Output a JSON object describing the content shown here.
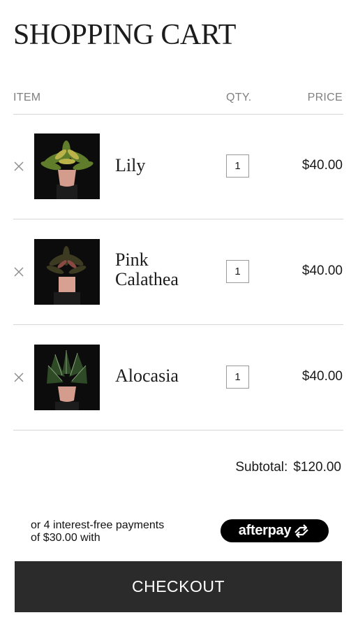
{
  "page": {
    "title": "SHOPPING CART"
  },
  "table": {
    "col_item": "ITEM",
    "col_qty": "QTY.",
    "col_price": "PRICE"
  },
  "items": [
    {
      "name_lines": [
        "Lily"
      ],
      "qty": "1",
      "price": "$40.00",
      "image": "plant-lily-icon"
    },
    {
      "name_lines": [
        "Pink",
        "Calathea"
      ],
      "qty": "1",
      "price": "$40.00",
      "image": "plant-pink-calathea-icon"
    },
    {
      "name_lines": [
        "Alocasia"
      ],
      "qty": "1",
      "price": "$40.00",
      "image": "plant-alocasia-icon"
    }
  ],
  "summary": {
    "subtotal_label": "Subtotal:",
    "subtotal_value": "$120.00"
  },
  "payment": {
    "line1": "or 4 interest-free payments",
    "line2": "of $30.00 with",
    "brand": "afterpay"
  },
  "checkout": {
    "label": "CHECKOUT"
  },
  "colors": {
    "button": "#2b2b2b",
    "afterpay_badge": "#000000",
    "divider": "#d6d6d6"
  }
}
